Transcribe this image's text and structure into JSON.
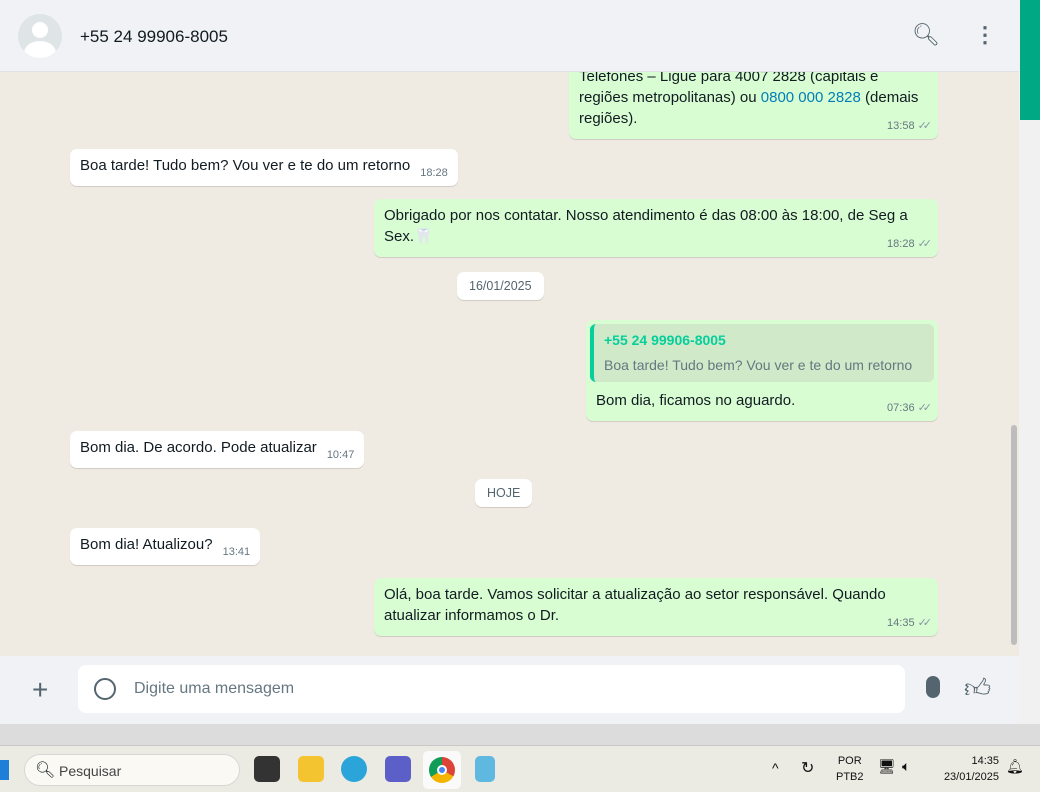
{
  "header": {
    "contact": "+55 24 99906-8005",
    "icons": [
      "search-icon",
      "menu-icon"
    ]
  },
  "messages": [
    {
      "dir": "out",
      "text_a": "Telefones – Ligue para 4007 2828 (capitais e regiões metropolitanas) ou ",
      "link": "0800 000 2828",
      "text_b": " (demais regiões).",
      "time": "13:58"
    },
    {
      "dir": "in",
      "text": "Boa tarde! Tudo bem? Vou ver e te do um retorno",
      "time": "18:28"
    },
    {
      "dir": "out",
      "text": "Obrigado por nos contatar. Nosso atendimento é das 08:00 às 18:00, de Seg a Sex.🦷",
      "time": "18:28"
    },
    {
      "dir": "out",
      "quote_name": "+55 24 99906-8005",
      "quote_text": "Boa tarde! Tudo bem? Vou ver e te do um retorno",
      "text": "Bom dia, ficamos no aguardo.",
      "time": "07:36"
    },
    {
      "dir": "in",
      "text": "Bom dia. De acordo. Pode atualizar",
      "time": "10:47"
    },
    {
      "dir": "in",
      "text": "Bom dia! Atualizou?",
      "time": "13:41"
    },
    {
      "dir": "out",
      "text": "Olá, boa tarde. Vamos solicitar a atualização ao setor responsável. Quando atualizar informamos o Dr.",
      "time": "14:35"
    }
  ],
  "dates": [
    "16/01/2025",
    "HOJE"
  ],
  "composer": {
    "placeholder": "Digite uma mensagem"
  },
  "taskbar": {
    "search": "Pesquisar",
    "lang1": "POR",
    "lang2": "PTB2",
    "time": "14:35",
    "date": "23/01/2025"
  },
  "colors": {
    "outgoing": "#d9fdd3",
    "accent": "#00a884",
    "link": "#027eb5"
  }
}
